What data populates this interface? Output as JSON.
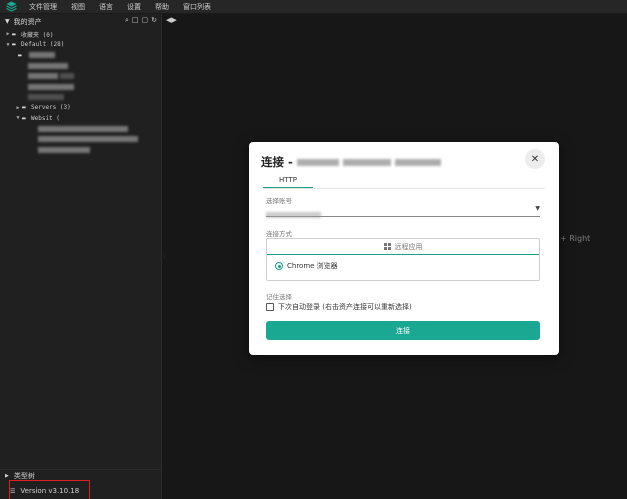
{
  "menubar": {
    "items": [
      "文件管理",
      "视图",
      "语言",
      "设置",
      "帮助",
      "窗口列表"
    ]
  },
  "sidebar": {
    "title": "我的资产",
    "tree": [
      {
        "label": "收藏夹 (0)",
        "expanded": false
      },
      {
        "label": "Default (28)",
        "expanded": true
      },
      {
        "label": "Servers (3)",
        "expanded": false
      },
      {
        "label": "Websit (",
        "expanded": true
      }
    ],
    "type_tree_label": "类型树",
    "version": "Version v3.10.18"
  },
  "main": {
    "split_label": "+ Right"
  },
  "dialog": {
    "title": "连接 -",
    "tab": "HTTP",
    "account_label": "选择账号",
    "method_label": "连接方式",
    "remote_app_label": "远程应用",
    "browser_option": "Chrome 浏览器",
    "remember_label": "记住选择",
    "auto_login_label": "下次自动登录 (右击资产连接可以重新选择)",
    "connect_button": "连接"
  },
  "colors": {
    "accent": "#1aa893",
    "sidebar_bg": "#202020",
    "main_bg": "#171717",
    "highlight": "#e02020"
  }
}
